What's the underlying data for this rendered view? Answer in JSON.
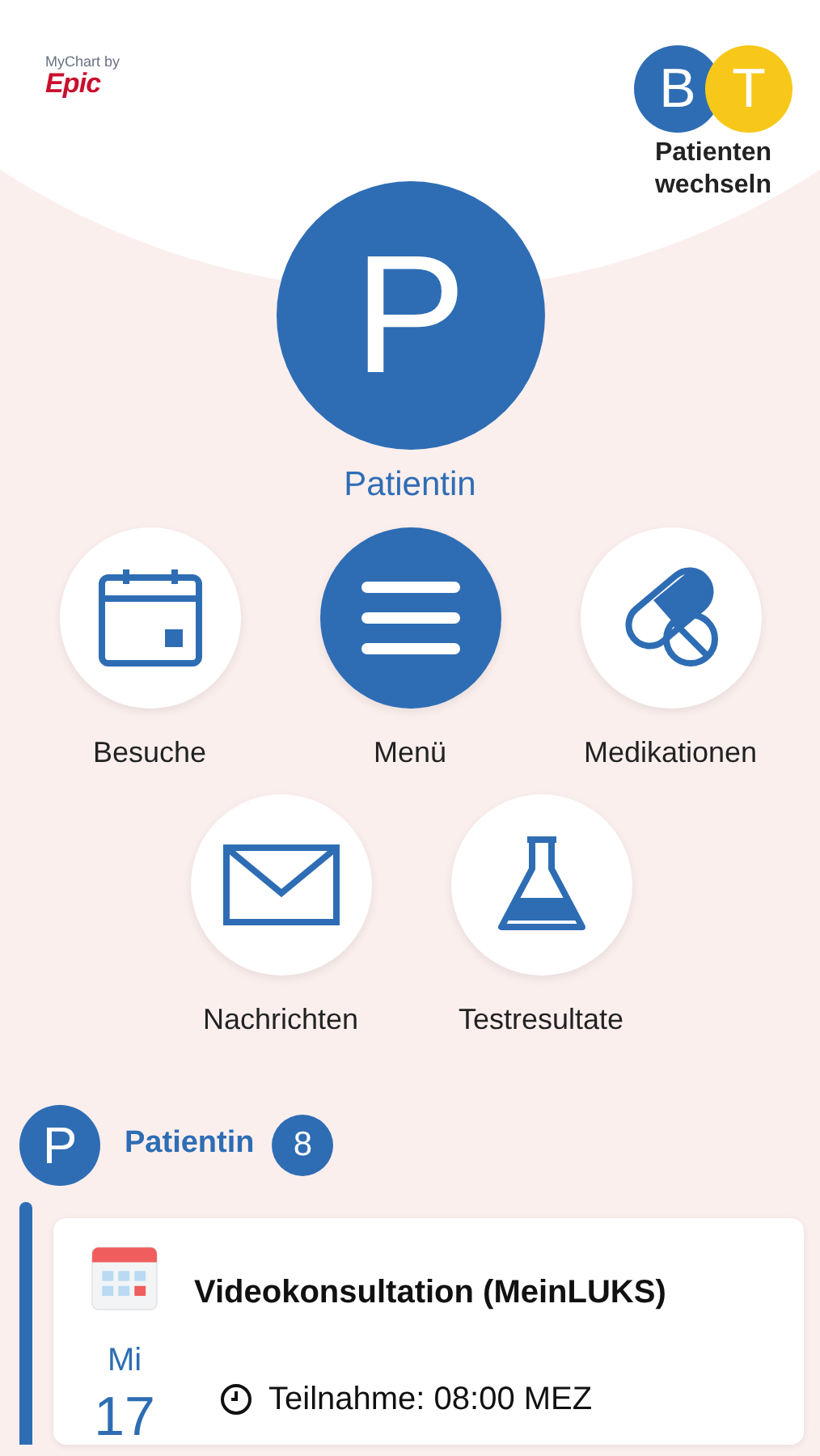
{
  "header": {
    "logo_caption": "MyChart by",
    "logo_brand": "Epic",
    "switch_patients": {
      "avatars": [
        {
          "initial": "B",
          "color": "#2e6db4"
        },
        {
          "initial": "T",
          "color": "#f7c81a"
        }
      ],
      "label": "Patienten wechseln"
    }
  },
  "profile": {
    "initial": "P",
    "name": "Patientin"
  },
  "shortcuts": [
    {
      "label": "Besuche",
      "kind": "calendar"
    },
    {
      "label": "Menü",
      "kind": "menu"
    },
    {
      "label": "Medikationen",
      "kind": "pills"
    },
    {
      "label": "Nachrichten",
      "kind": "mail"
    },
    {
      "label": "Testresultate",
      "kind": "flask"
    }
  ],
  "feed": {
    "avatar_initial": "P",
    "name": "Patientin",
    "count": "8",
    "cards": [
      {
        "title": "Videokonsultation (MeinLUKS)",
        "weekday": "Mi",
        "day": "17",
        "detail": "Teilnahme: 08:00 MEZ"
      }
    ]
  }
}
